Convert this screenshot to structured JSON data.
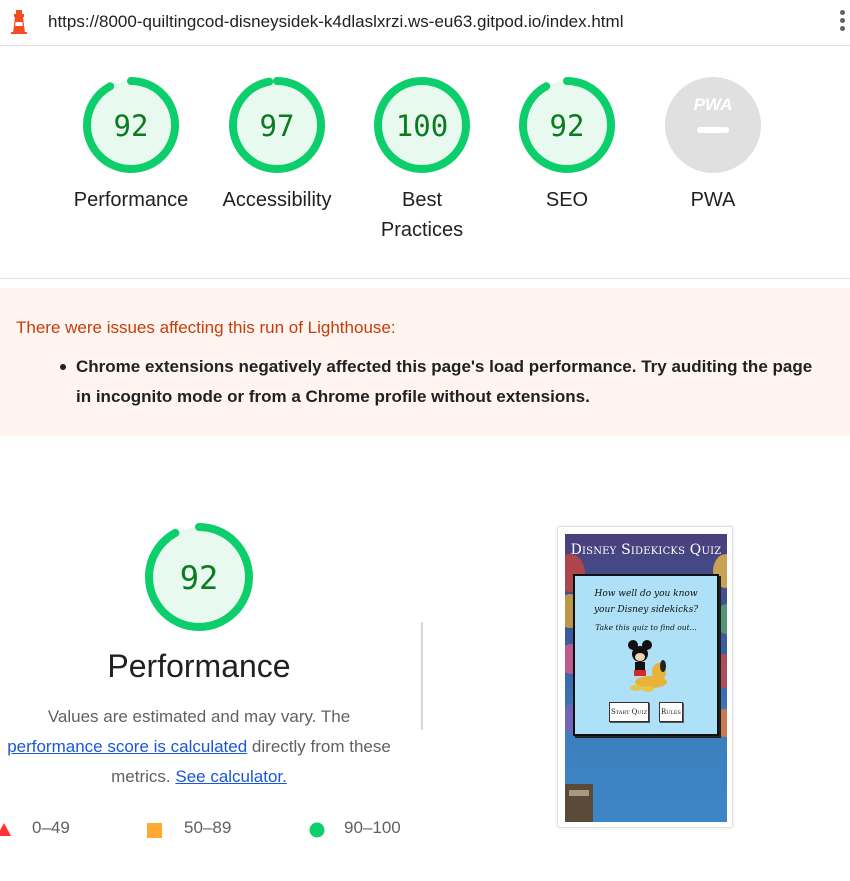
{
  "address_bar": {
    "url": "https://8000-quiltingcod-disneysidek-k4dlaslxrzi.ws-eu63.gitpod.io/index.html"
  },
  "categories": [
    {
      "label": "Performance",
      "score": "92",
      "score_value": 0.92,
      "color": "#0cce6b"
    },
    {
      "label": "Accessibility",
      "score": "97",
      "score_value": 0.97,
      "color": "#0cce6b"
    },
    {
      "label": "Best Practices",
      "label_line1": "Best",
      "label_line2": "Practices",
      "score": "100",
      "score_value": 1.0,
      "color": "#0cce6b"
    },
    {
      "label": "SEO",
      "score": "92",
      "score_value": 0.92,
      "color": "#0cce6b"
    },
    {
      "label": "PWA",
      "badge": "PWA",
      "score": null,
      "color": "#e0e0e0"
    }
  ],
  "warning": {
    "title": "There were issues affecting this run of Lighthouse:",
    "items": [
      "Chrome extensions negatively affected this page's load performance. Try auditing the page in incognito mode or from a Chrome profile without extensions."
    ]
  },
  "performance": {
    "score": "92",
    "score_value": 0.92,
    "title": "Performance",
    "desc_line1": "Values are estimated and may vary. The",
    "desc_link1": "performance score is calculated",
    "desc_mid": " directly from these",
    "desc_line3": "metrics. ",
    "desc_link2": "See calculator.",
    "legend": [
      {
        "range": "0–49",
        "shape": "triangle",
        "color": "#ff3333"
      },
      {
        "range": "50–89",
        "shape": "square",
        "color": "#ffaa33"
      },
      {
        "range": "90–100",
        "shape": "circle",
        "color": "#0cce6b"
      }
    ]
  },
  "screenshot": {
    "title": "Disney Sidekicks Quiz",
    "question_line1": "How well do you know",
    "question_line2": "your Disney sidekicks?",
    "subtitle": "Take this quiz to find out...",
    "start_button": "Start Quiz",
    "rules_button": "Rules"
  }
}
